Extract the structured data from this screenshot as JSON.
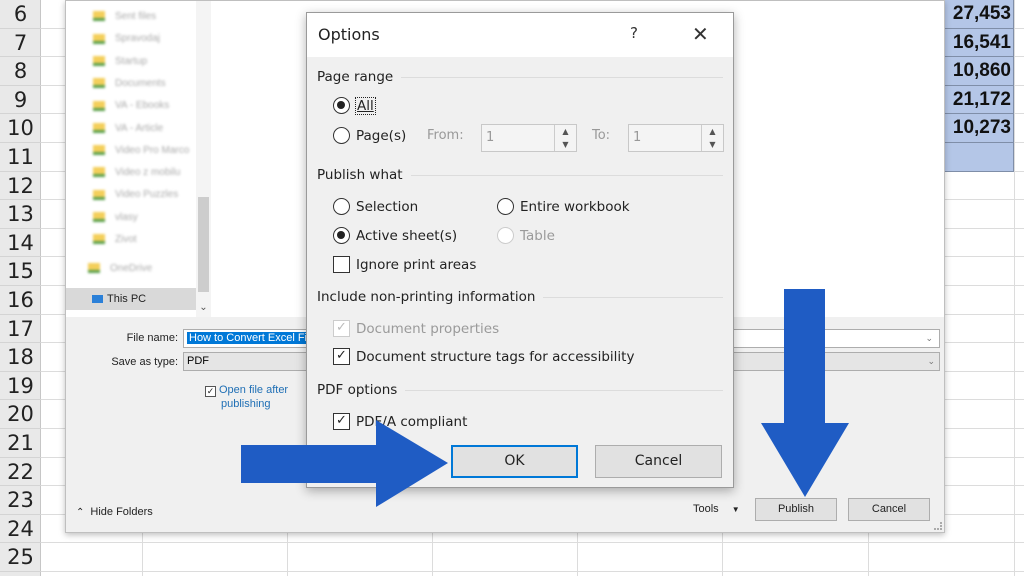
{
  "sheet": {
    "row_numbers": [
      "6",
      "7",
      "8",
      "9",
      "10",
      "11",
      "12",
      "13",
      "14",
      "15",
      "16",
      "17",
      "18",
      "19",
      "20",
      "21",
      "22",
      "23",
      "24",
      "25"
    ],
    "selected_values": [
      "27,453",
      "16,541",
      "10,860",
      "21,172",
      "10,273",
      ""
    ],
    "selection_color": "#b4c6e7"
  },
  "file_dialog": {
    "nav_items": [
      {
        "label": "Sent files",
        "icon": "folder-icon",
        "blurred": true
      },
      {
        "label": "Spravodaj",
        "icon": "folder-icon",
        "blurred": true
      },
      {
        "label": "Startup",
        "icon": "folder-icon",
        "blurred": true
      },
      {
        "label": "Documents",
        "icon": "folder-icon",
        "blurred": true
      },
      {
        "label": "VA - Ebooks",
        "icon": "folder-icon",
        "blurred": true
      },
      {
        "label": "VA - Article",
        "icon": "folder-icon",
        "blurred": true
      },
      {
        "label": "Video Pro Marco",
        "icon": "folder-icon",
        "blurred": true
      },
      {
        "label": "Video z mobilu",
        "icon": "folder-icon",
        "blurred": true
      },
      {
        "label": "Video Puzzles",
        "icon": "folder-icon",
        "blurred": true
      },
      {
        "label": "vlasy",
        "icon": "folder-icon",
        "blurred": true
      },
      {
        "label": "Zivot",
        "icon": "folder-icon",
        "blurred": true
      },
      {
        "label": "OneDrive",
        "icon": "folder-icon",
        "blurred": true
      }
    ],
    "this_pc_label": "This PC",
    "file_name_label": "File name:",
    "file_name_value": "How to Convert Excel Fi",
    "save_as_type_label": "Save as type:",
    "save_as_type_value": "PDF",
    "open_after_label_1": "Open file after",
    "open_after_label_2": "publishing",
    "open_after_checked": true,
    "hide_folders_label": "Hide Folders",
    "tools_label": "Tools",
    "publish_label": "Publish",
    "cancel_label": "Cancel"
  },
  "options_dialog": {
    "title": "Options",
    "help_glyph": "?",
    "close_glyph": "✕",
    "page_range": {
      "heading": "Page range",
      "all_label": "All",
      "pages_label": "Page(s)",
      "selected": "All",
      "from_label": "From:",
      "from_value": "1",
      "to_label": "To:",
      "to_value": "1"
    },
    "publish_what": {
      "heading": "Publish what",
      "selection_label": "Selection",
      "entire_workbook_label": "Entire workbook",
      "active_sheets_label": "Active sheet(s)",
      "table_label": "Table",
      "selected": "Active sheet(s)",
      "ignore_print_areas_label": "Ignore print areas",
      "ignore_print_areas_checked": false
    },
    "non_printing": {
      "heading": "Include non-printing information",
      "doc_properties_label": "Document properties",
      "doc_properties_checked": true,
      "doc_structure_label": "Document structure tags for accessibility",
      "doc_structure_checked": true
    },
    "pdf_options": {
      "heading": "PDF options",
      "pdfa_label": "PDF/A compliant",
      "pdfa_checked": true
    },
    "ok_label": "OK",
    "cancel_label": "Cancel"
  },
  "annotations": {
    "arrow_color": "#1f5cc4",
    "arrows": [
      {
        "points_to": "OK button",
        "direction": "right"
      },
      {
        "points_to": "Publish button",
        "direction": "down"
      }
    ]
  }
}
